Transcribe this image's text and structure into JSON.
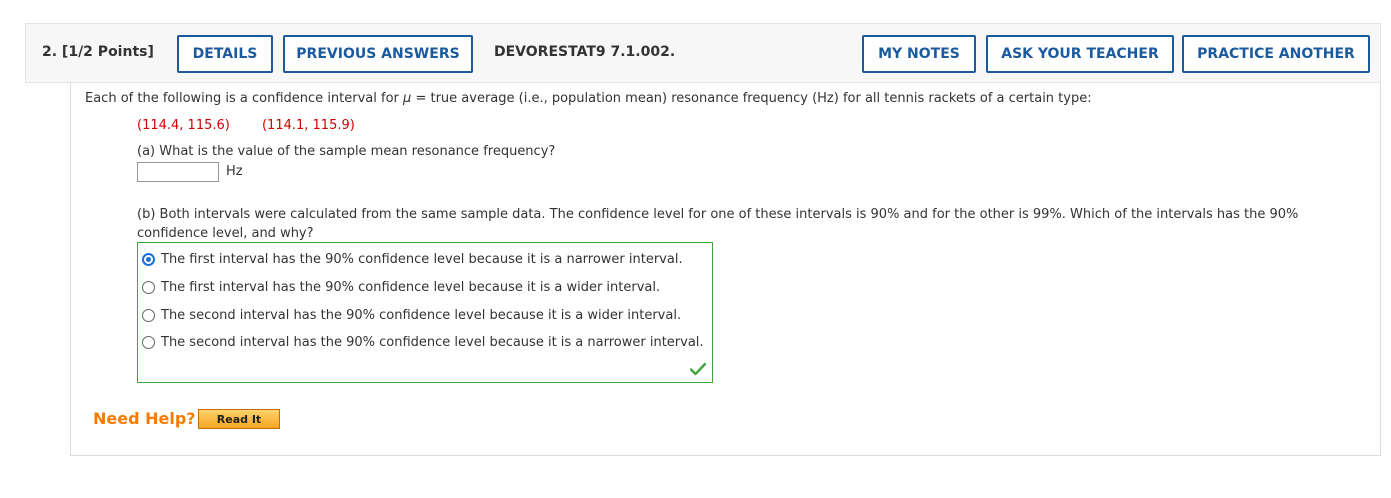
{
  "header": {
    "question_label": "2. [1/2 Points]",
    "details_label": "DETAILS",
    "previous_answers_label": "PREVIOUS ANSWERS",
    "assignment_code": "DEVORESTAT9 7.1.002.",
    "my_notes_label": "MY NOTES",
    "ask_teacher_label": "ASK YOUR TEACHER",
    "practice_another_label": "PRACTICE ANOTHER"
  },
  "question": {
    "intro_before": "Each of the following is a confidence interval for ",
    "intro_symbol": "μ",
    "intro_after": " = true average (i.e., population mean) resonance frequency (Hz) for all tennis rackets of a certain type:",
    "interval_1": "(114.4, 115.6)",
    "interval_2": "(114.1, 115.9)",
    "part_a": {
      "prompt": "(a) What is the value of the sample mean resonance frequency?",
      "value": "",
      "unit": "Hz"
    },
    "part_b": {
      "prompt": "(b) Both intervals were calculated from the same sample data. The confidence level for one of these intervals is 90% and for the other is 99%. Which of the intervals has the 90% confidence level, and why?",
      "choices": [
        {
          "label": "The first interval has the 90% confidence level because it is a narrower interval.",
          "selected": true
        },
        {
          "label": "The first interval has the 90% confidence level because it is a wider interval.",
          "selected": false
        },
        {
          "label": "The second interval has the 90% confidence level because it is a wider interval.",
          "selected": false
        },
        {
          "label": "The second interval has the 90% confidence level because it is a narrower interval.",
          "selected": false
        }
      ],
      "status_icon": "check-icon",
      "status_color": "#3fa63f"
    }
  },
  "help": {
    "need_help_label": "Need Help?",
    "read_it_label": "Read It"
  },
  "colors": {
    "accent": "#1c5a9e",
    "interval_red": "#d10000",
    "help_orange": "#f57c00",
    "correct_green": "#3fa63f"
  }
}
